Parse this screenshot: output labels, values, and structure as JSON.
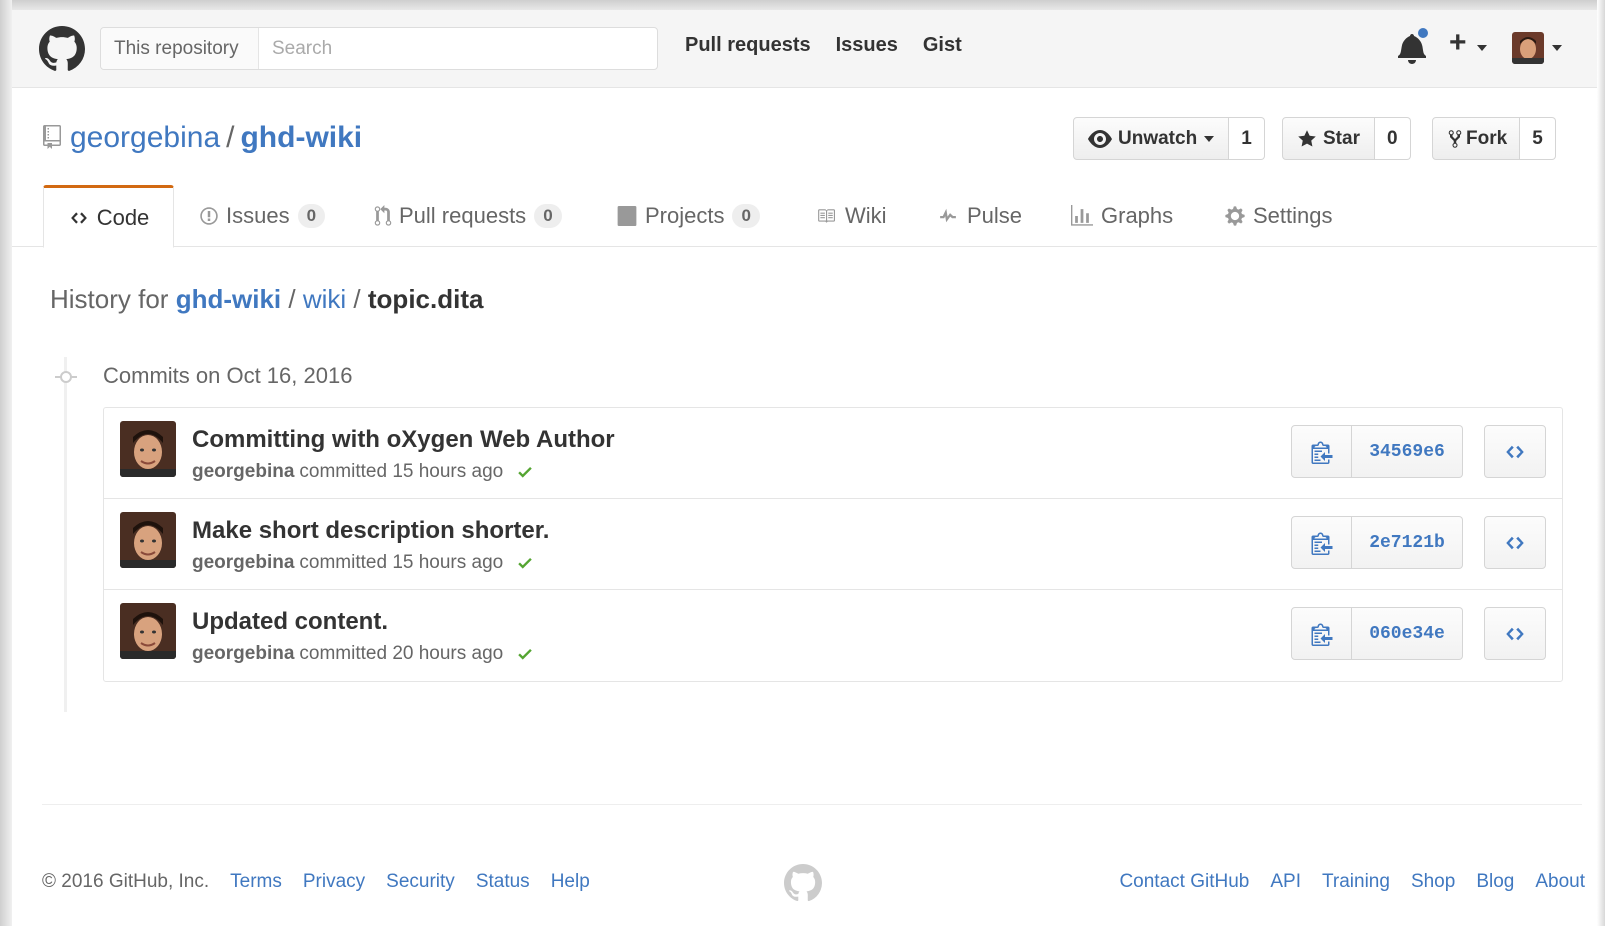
{
  "header": {
    "search_scope": "This repository",
    "search_placeholder": "Search",
    "nav": [
      "Pull requests",
      "Issues",
      "Gist"
    ]
  },
  "repo": {
    "owner": "georgebina",
    "separator": "/",
    "name": "ghd-wiki",
    "watch_label": "Unwatch",
    "watch_count": "1",
    "star_label": "Star",
    "star_count": "0",
    "fork_label": "Fork",
    "fork_count": "5"
  },
  "tabs": [
    {
      "label": "Code",
      "icon": "code-icon"
    },
    {
      "label": "Issues",
      "count": "0",
      "icon": "issue-icon"
    },
    {
      "label": "Pull requests",
      "count": "0",
      "icon": "pull-request-icon"
    },
    {
      "label": "Projects",
      "count": "0",
      "icon": "project-icon"
    },
    {
      "label": "Wiki",
      "icon": "book-icon"
    },
    {
      "label": "Pulse",
      "icon": "pulse-icon"
    },
    {
      "label": "Graphs",
      "icon": "graph-icon"
    },
    {
      "label": "Settings",
      "icon": "gear-icon"
    }
  ],
  "breadcrumb": {
    "prefix": "History for",
    "repo": "ghd-wiki",
    "sep1": "/",
    "folder": "wiki",
    "sep2": "/",
    "file": "topic.dita"
  },
  "commits_date": "Commits on Oct 16, 2016",
  "commits": [
    {
      "message": "Committing with oXygen Web Author",
      "author": "georgebina",
      "time": "committed 15 hours ago",
      "sha": "34569e6"
    },
    {
      "message": "Make short description shorter.",
      "author": "georgebina",
      "time": "committed 15 hours ago",
      "sha": "2e7121b"
    },
    {
      "message": "Updated content.",
      "author": "georgebina",
      "time": "committed 20 hours ago",
      "sha": "060e34e"
    }
  ],
  "footer": {
    "copyright": "© 2016 GitHub, Inc.",
    "left_links": [
      "Terms",
      "Privacy",
      "Security",
      "Status",
      "Help"
    ],
    "right_links": [
      "Contact GitHub",
      "API",
      "Training",
      "Shop",
      "Blog",
      "About"
    ]
  },
  "colors": {
    "link": "#4078c0",
    "tab_accent": "#d26911",
    "success": "#55a532"
  }
}
